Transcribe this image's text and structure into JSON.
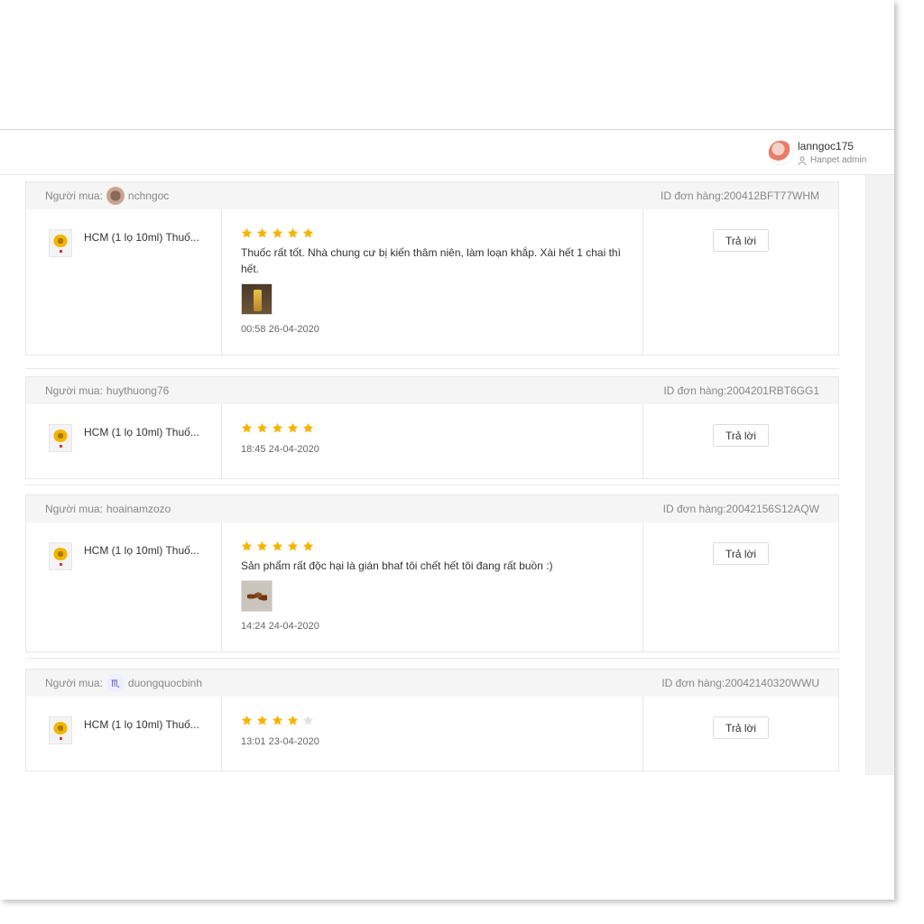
{
  "user": {
    "name": "lanngoc175",
    "role": "Hanpet admin"
  },
  "labels": {
    "buyer_prefix": "Người mua:",
    "order_prefix": "ID đơn hàng:",
    "reply": "Trả lời"
  },
  "reviews": [
    {
      "buyer": "nchngoc",
      "buyer_icon": "user-avatar",
      "order_id": "200412BFT77WHM",
      "product": "HCM (1 lọ 10ml) Thuố...",
      "rating": 5,
      "text": "Thuốc rất tốt. Nhà chung cư bị kiến thâm niên, làm loạn khắp. Xài hết 1 chai thì hết.",
      "image": "bottle-photo",
      "time": "00:58 26-04-2020"
    },
    {
      "buyer": "huythuong76",
      "buyer_icon": "",
      "order_id": "2004201RBT6GG1",
      "product": "HCM (1 lọ 10ml) Thuố...",
      "rating": 5,
      "text": "",
      "image": "",
      "time": "18:45 24-04-2020"
    },
    {
      "buyer": "hoainamzozo",
      "buyer_icon": "",
      "order_id": "20042156S12AQW",
      "product": "HCM (1 lọ 10ml) Thuố...",
      "rating": 5,
      "text": "Sản phẩm rất độc hại là gián bhaf tôi chết hết tôi đang rất buồn :)",
      "image": "cockroach-photo",
      "time": "14:24 24-04-2020"
    },
    {
      "buyer": "duongquocbinh",
      "buyer_icon": "scorpio-sign",
      "order_id": "20042140320WWU",
      "product": "HCM (1 lọ 10ml) Thuố...",
      "rating": 4,
      "text": "",
      "image": "",
      "time": "13:01 23-04-2020"
    }
  ],
  "colors": {
    "star_on": "#f5b400",
    "star_off": "#e3e3e3",
    "header_bg": "#f5f5f5"
  }
}
